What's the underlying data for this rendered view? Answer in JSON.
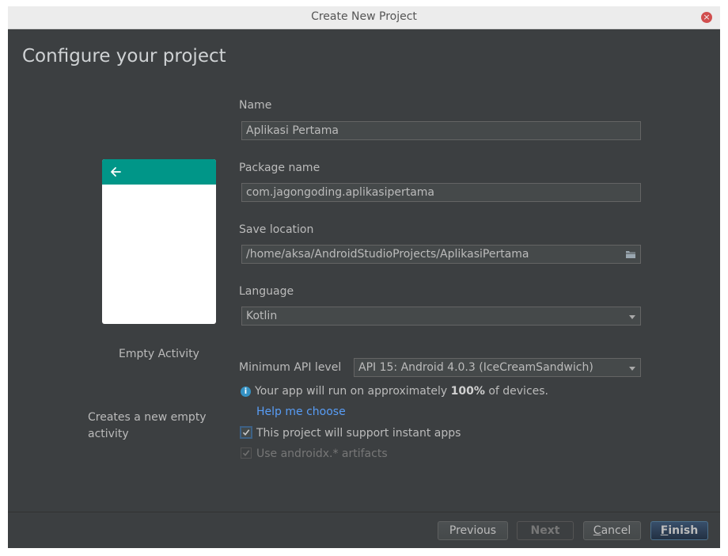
{
  "window": {
    "title": "Create New Project",
    "close_glyph": "×"
  },
  "header": {
    "title": "Configure your project"
  },
  "template": {
    "name": "Empty Activity",
    "description": "Creates a new empty activity",
    "appbar_color": "#009688"
  },
  "form": {
    "name": {
      "label": "Name",
      "value": "Aplikasi Pertama"
    },
    "package": {
      "label": "Package name",
      "value": "com.jagongoding.aplikasipertama"
    },
    "location": {
      "label": "Save location",
      "value": "/home/aksa/AndroidStudioProjects/AplikasiPertama"
    },
    "language": {
      "label": "Language",
      "value": "Kotlin"
    },
    "min_api": {
      "label": "Minimum API level",
      "value": "API 15: Android 4.0.3 (IceCreamSandwich)"
    },
    "info": {
      "prefix": "Your app will run on approximately ",
      "percent": "100%",
      "suffix": " of devices."
    },
    "help_link": "Help me choose",
    "instant_apps": {
      "label": "This project will support instant apps",
      "checked": true
    },
    "androidx": {
      "label": "Use androidx.* artifacts",
      "checked": true
    }
  },
  "buttons": {
    "previous": "Previous",
    "next": "Next",
    "cancel_mnemonic": "C",
    "cancel_rest": "ancel",
    "finish_mnemonic": "F",
    "finish_rest": "inish"
  },
  "colors": {
    "accent": "#009688",
    "link": "#589df6",
    "info": "#3592c4",
    "close": "#d14f4f"
  }
}
